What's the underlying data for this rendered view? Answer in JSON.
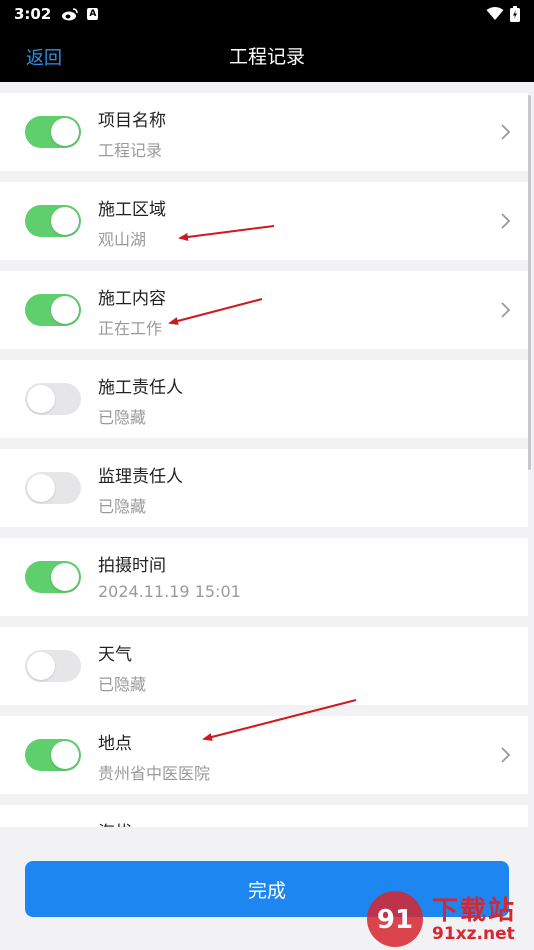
{
  "status_bar": {
    "time": "3:02",
    "a_icon_label": "A"
  },
  "header": {
    "back_label": "返回",
    "title": "工程记录"
  },
  "items": [
    {
      "title": "项目名称",
      "subtitle": "工程记录",
      "enabled": true,
      "has_chevron": true
    },
    {
      "title": "施工区域",
      "subtitle": "观山湖",
      "enabled": true,
      "has_chevron": true
    },
    {
      "title": "施工内容",
      "subtitle": "正在工作",
      "enabled": true,
      "has_chevron": true
    },
    {
      "title": "施工责任人",
      "subtitle": "已隐藏",
      "enabled": false,
      "has_chevron": false
    },
    {
      "title": "监理责任人",
      "subtitle": "已隐藏",
      "enabled": false,
      "has_chevron": false
    },
    {
      "title": "拍摄时间",
      "subtitle": "2024.11.19 15:01",
      "enabled": true,
      "has_chevron": false
    },
    {
      "title": "天气",
      "subtitle": "已隐藏",
      "enabled": false,
      "has_chevron": false
    },
    {
      "title": "地点",
      "subtitle": "贵州省中医医院",
      "enabled": true,
      "has_chevron": true
    },
    {
      "title": "海拔",
      "subtitle": "",
      "enabled": true,
      "has_chevron": false
    }
  ],
  "footer": {
    "done_label": "完成"
  },
  "watermark": {
    "top_text": "下载站",
    "bottom_text": "91xz.net",
    "badge_text": "91"
  },
  "colors": {
    "accent": "#1e86f0",
    "toggle_on": "#5fce6c",
    "back_link": "#2f8ee8",
    "annotation_arrow": "#d0181f"
  }
}
